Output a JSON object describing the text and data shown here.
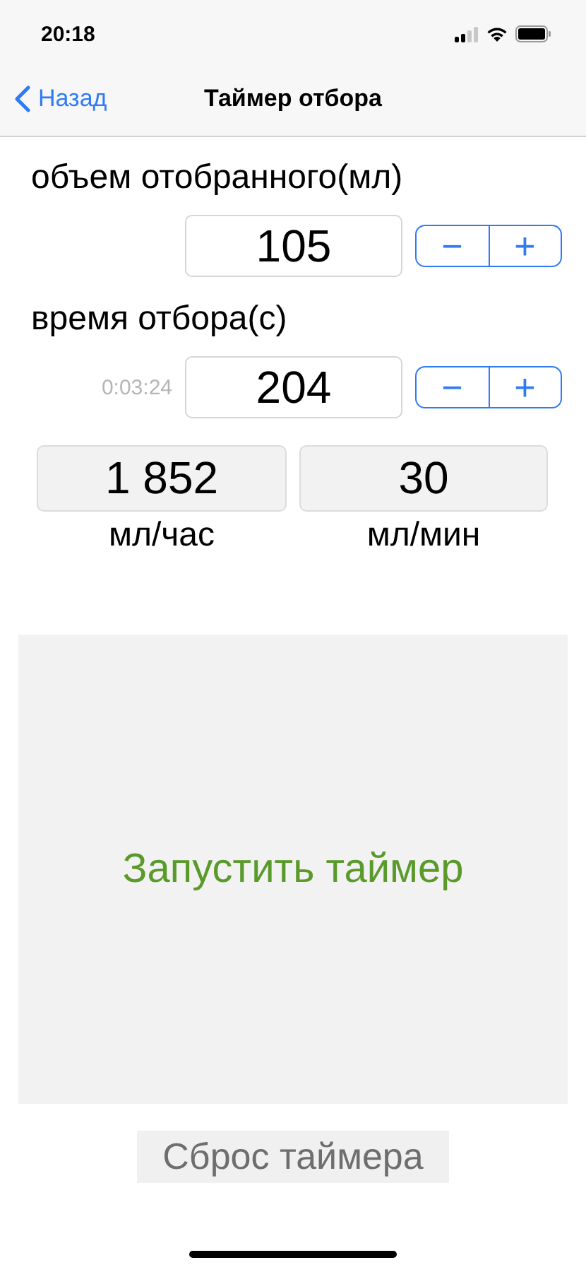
{
  "status_bar": {
    "time": "20:18"
  },
  "nav": {
    "back": "Назад",
    "title": "Таймер отбора"
  },
  "inputs": [
    {
      "label": "объем отобранного(мл)",
      "value": "105",
      "minus": "−",
      "plus": "+"
    },
    {
      "label": "время отбора(с)",
      "value": "204",
      "hint": "0:03:24",
      "minus": "−",
      "plus": "+"
    }
  ],
  "results": [
    {
      "value": "1 852",
      "unit": "мл/час"
    },
    {
      "value": "30",
      "unit": "мл/мин"
    }
  ],
  "start_button": "Запустить таймер",
  "reset_button": "Сброс таймера"
}
